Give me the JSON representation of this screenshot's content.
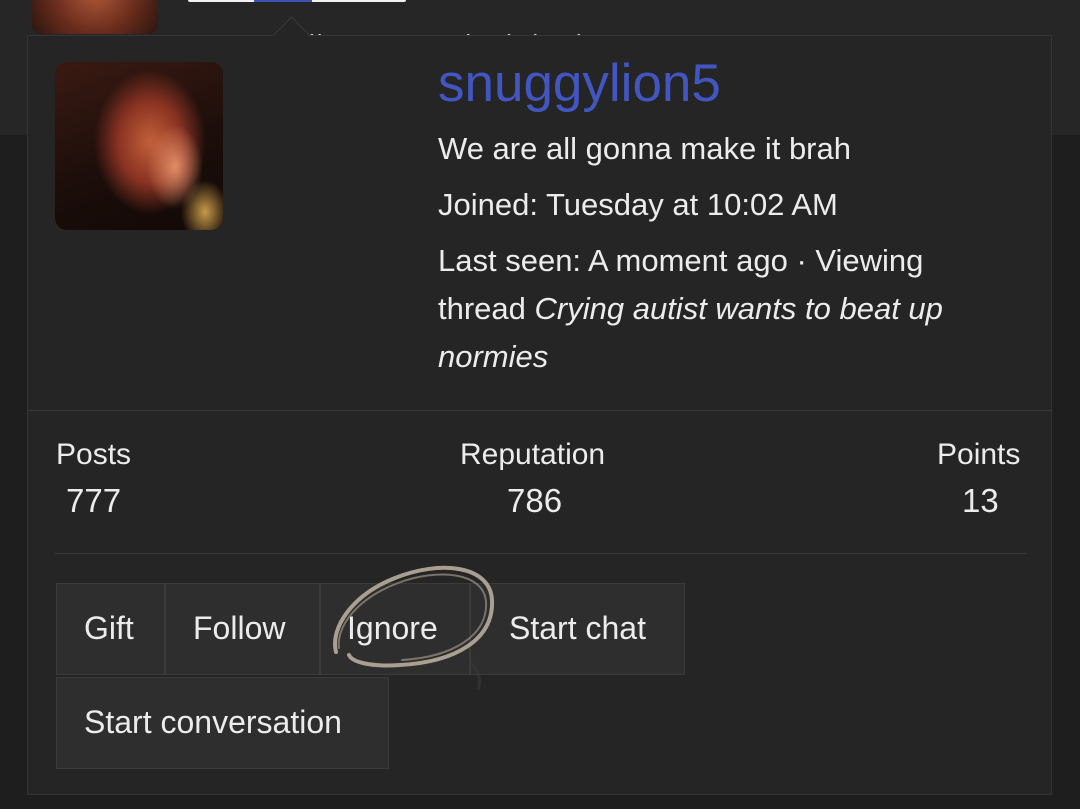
{
  "profile": {
    "username": "snuggylion5",
    "status": "We are all gonna make it brah",
    "joined": "Joined: Tuesday at 10:02 AM",
    "last_seen_prefix": "Last seen: A moment ago · Viewing thread ",
    "last_seen_thread": "Crying autist wants to beat up normies"
  },
  "stats": [
    {
      "label": "Posts",
      "value": "777"
    },
    {
      "label": "Reputation",
      "value": "786"
    },
    {
      "label": "Points",
      "value": "13"
    }
  ],
  "actions": {
    "gift": "Gift",
    "follow": "Follow",
    "ignore": "Ignore",
    "start_chat": "Start chat",
    "start_conversation": "Start conversation"
  },
  "background": {
    "status_partial": "We are all gonna make it brah"
  },
  "colors": {
    "username": "#4256c2",
    "card_bg": "#252525",
    "button_bg": "#2e2e2e"
  }
}
